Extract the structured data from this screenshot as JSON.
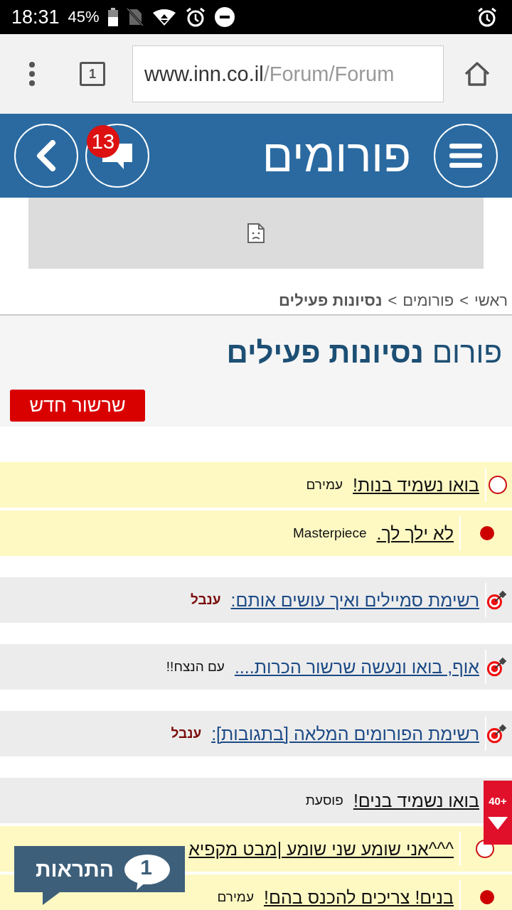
{
  "status_bar": {
    "time": "18:31",
    "battery": "45%"
  },
  "browser": {
    "tab_count": "1",
    "url_host": "www.inn.co.il",
    "url_path": "/Forum/Forum"
  },
  "header": {
    "title": "פורומים",
    "message_count": "13"
  },
  "breadcrumb": {
    "items": [
      {
        "label": "ראשי",
        "current": false
      },
      {
        "label": "פורומים",
        "current": false
      },
      {
        "label": "נסיונות פעילים",
        "current": true
      }
    ],
    "separators": [
      ">",
      ">"
    ]
  },
  "forum": {
    "title": "פורום **נסיונות פעילים**",
    "new_thread_button": "שרשור חדש"
  },
  "groups": [
    {
      "rows": [
        {
          "kind": "new",
          "highlighted": true,
          "pinned_style": false,
          "title": "בואו נשמיד בנות!",
          "author": "עמירם",
          "color": "#111111",
          "children": [
            {
              "kind": "read",
              "highlighted": true,
              "pinned_style": false,
              "title": "לא ילך לך.",
              "author": "Masterpiece",
              "color": "#111111"
            }
          ]
        }
      ]
    },
    {
      "rows": [
        {
          "kind": "pinned",
          "highlighted": false,
          "pinned_style": true,
          "title": "רשימת סמיילים ואיך עושים אותם:",
          "author": "ענבל",
          "color": "#7a0c0c"
        }
      ]
    },
    {
      "rows": [
        {
          "kind": "pinned",
          "highlighted": false,
          "pinned_style": true,
          "title": "אוף, בואו ונעשה שרשור הכרות....",
          "author": "עם הנצח!!",
          "color": "#111111"
        }
      ]
    },
    {
      "rows": [
        {
          "kind": "pinned",
          "highlighted": false,
          "pinned_style": true,
          "title": "רשימת הפורומים המלאה [בתגובות]:",
          "author": "ענבל",
          "color": "#7a0c0c"
        }
      ]
    },
    {
      "rows": [
        {
          "highlighted": false,
          "pinned_style": false,
          "title": "בואו נשמיד בנים!",
          "author": "פוסעת",
          "color": "#111111",
          "children": [
            {
              "kind": "new",
              "highlighted": true,
              "pinned_style": false,
              "title": "^^^אני שומע שני שומע |מבט מקפיא"
            },
            {
              "kind": "read",
              "highlighted": true,
              "pinned_style": false,
              "title": "בנים! צריכים להכנס בהם!",
              "author": "עמירם",
              "color": "#111111"
            }
          ]
        }
      ]
    }
  ],
  "scroll_badge": {
    "label": "40+"
  },
  "notifications": {
    "count": "1",
    "label": "התראות"
  }
}
